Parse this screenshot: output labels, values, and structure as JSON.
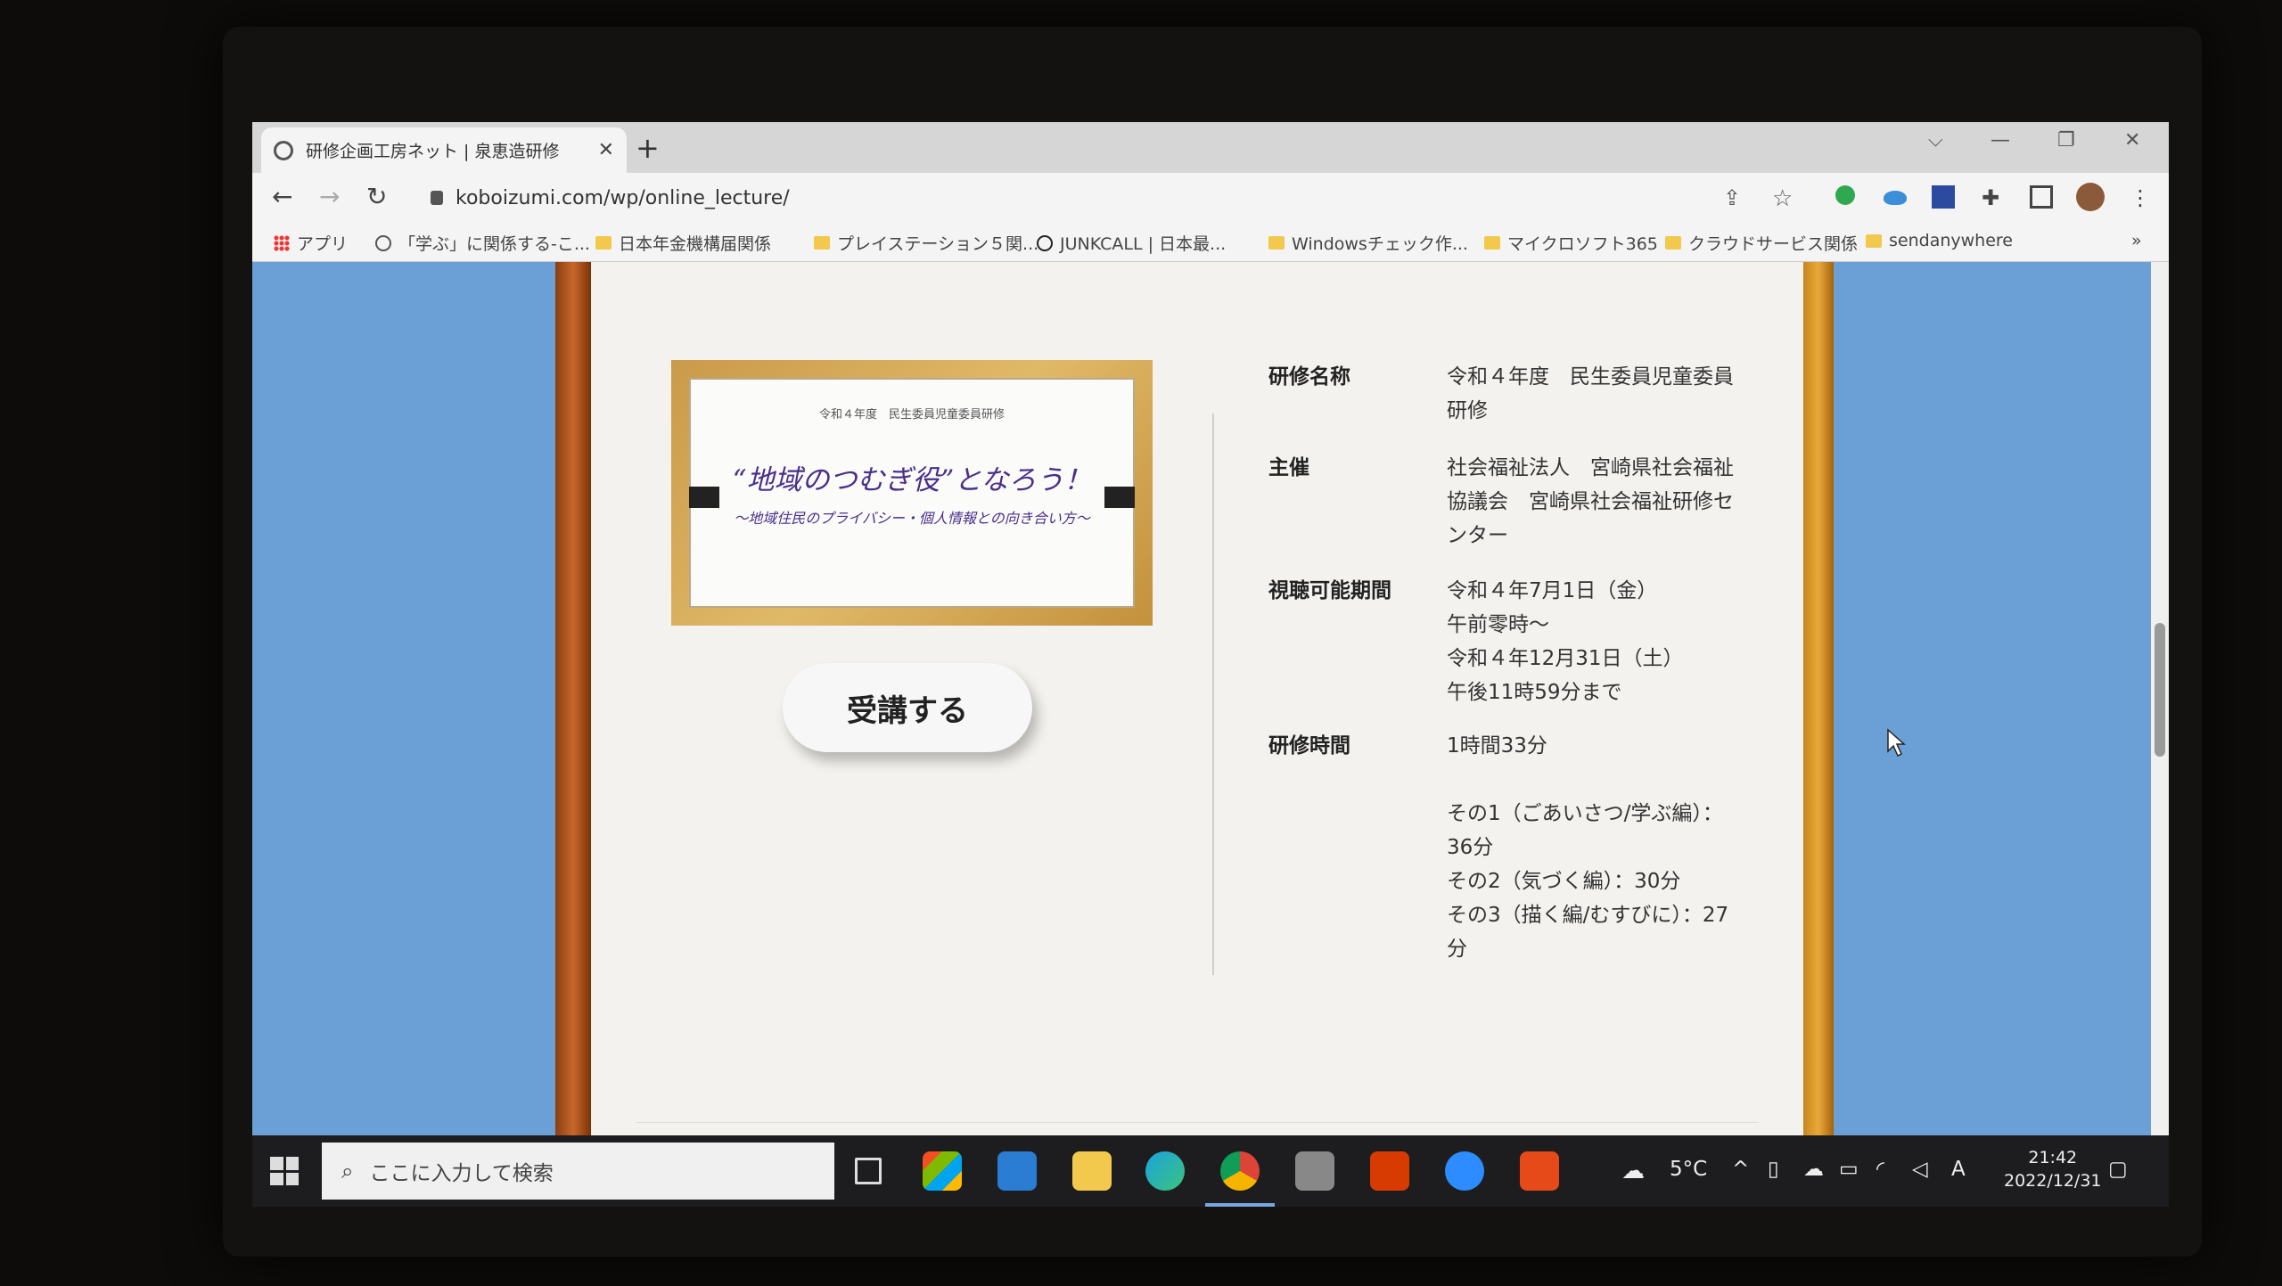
{
  "browser": {
    "tab_title": "研修企画工房ネット | 泉恵造研修",
    "url": "koboizumi.com/wp/online_lecture/",
    "bookmarks": [
      {
        "label": "アプリ",
        "icon": "apps-icon"
      },
      {
        "label": "「学ぶ」に関係する-こ...",
        "icon": "globe-icon"
      },
      {
        "label": "日本年金機構届関係",
        "icon": "folder-icon"
      },
      {
        "label": "プレイステーション５関...",
        "icon": "folder-icon"
      },
      {
        "label": "JUNKCALL | 日本最...",
        "icon": "site-icon"
      },
      {
        "label": "Windowsチェック作...",
        "icon": "folder-icon"
      },
      {
        "label": "マイクロソフト365",
        "icon": "folder-icon"
      },
      {
        "label": "クラウドサービス関係",
        "icon": "folder-icon"
      },
      {
        "label": "sendanywhere",
        "icon": "folder-icon"
      }
    ],
    "bookmarks_more": "»"
  },
  "banner": {
    "small_heading": "令和４年度　民生委員児童委員研修",
    "main_title": "“地域のつむぎ役”となろう！",
    "subtitle": "〜地域住民のプライバシー・個人情報との向き合い方〜"
  },
  "enroll_button": "受講する",
  "info": {
    "name_label": "研修名称",
    "name_value_1": "令和４年度　民生委員児童委員",
    "name_value_2": "研修",
    "host_label": "主催",
    "host_value_1": "社会福祉法人　宮崎県社会福祉",
    "host_value_2": "協議会　宮崎県社会福祉研修セ",
    "host_value_3": "ンター",
    "period_label": "視聴可能期間",
    "period_value_1": "令和４年7月1日（金）",
    "period_value_2": "午前零時〜",
    "period_value_3": "令和４年12月31日（土）",
    "period_value_4": "午後11時59分まで",
    "duration_label": "研修時間",
    "duration_total": "1時間33分",
    "part1_a": "その1（ごあいさつ/学ぶ編）：",
    "part1_b": "36分",
    "part2": "その2（気づく編）：30分",
    "part3_a": "その3（描く編/むすびに）：27",
    "part3_b": "分"
  },
  "taskbar": {
    "search_placeholder": "ここに入力して検索",
    "weather": "5°C",
    "time": "21:42",
    "date": "2022/12/31",
    "ime": "A"
  },
  "colors": {
    "accent_purple": "#4a2f8a",
    "page_background": "#6aa0d6"
  }
}
